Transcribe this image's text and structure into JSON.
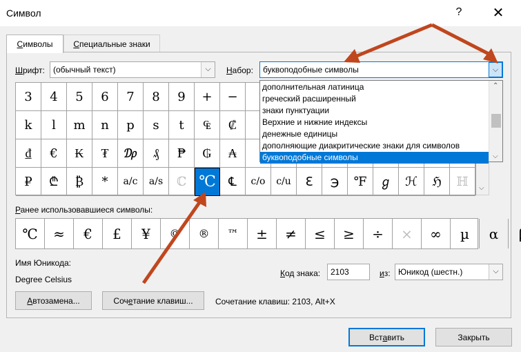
{
  "window": {
    "title": "Символ",
    "help_label": "?",
    "close_label": "✕"
  },
  "tabs": [
    {
      "label_ul": "С",
      "label_rest": "имволы"
    },
    {
      "label_ul": "С",
      "label_rest": "пециальные знаки"
    }
  ],
  "font": {
    "label_ul": "Ш",
    "label_rest": "рифт:",
    "value": "(обычный текст)"
  },
  "subset": {
    "label_ul": "Н",
    "label_rest": "абор:",
    "value": "буквоподобные символы",
    "options": [
      "дополнительная латиница",
      "греческий расширенный",
      "знаки пунктуации",
      "Верхние и нижние индексы",
      "денежные единицы",
      "дополняющие диакритические знаки для символов",
      "буквоподобные символы"
    ],
    "selected_index": 6
  },
  "symbols": [
    [
      "3",
      "4",
      "5",
      "6",
      "7",
      "8",
      "9",
      "+",
      "−",
      "",
      "",
      "",
      "",
      "",
      "",
      "",
      "",
      ""
    ],
    [
      "k",
      "l",
      "m",
      "n",
      "p",
      "s",
      "t",
      "₠",
      "₡",
      "",
      "",
      "",
      "",
      "",
      "",
      "",
      "",
      ""
    ],
    [
      "₫",
      "€",
      "₭",
      "₮",
      "₯",
      "₰",
      "₱",
      "₲",
      "₳",
      "",
      "",
      "",
      "",
      "",
      "",
      "",
      "",
      ""
    ],
    [
      "₽",
      "₾",
      "₿",
      "*",
      "a/c",
      "a/s",
      "ℂ",
      "℃",
      "℄",
      "c/o",
      "c/u",
      "ℇ",
      "℈",
      "℉",
      "ℊ",
      "ℋ",
      "ℌ",
      "ℍ"
    ]
  ],
  "selected_symbol": "℃",
  "recent_label_rest": "анее использовавшиеся символы:",
  "recent_label_ul": "Р",
  "recent": [
    "℃",
    "≈",
    "€",
    "£",
    "¥",
    "©",
    "®",
    "™",
    "±",
    "≠",
    "≤",
    "≥",
    "÷",
    "×",
    "∞",
    "µ",
    "α",
    "β"
  ],
  "unicode_name_label": "Имя Юникода:",
  "unicode_name": "Degree Celsius",
  "char_code": {
    "label_ul": "К",
    "label_rest": "од знака:",
    "value": "2103"
  },
  "from": {
    "label_ul": "и",
    "label_rest": "з:",
    "value": "Юникод (шестн.)"
  },
  "buttons": {
    "autocorrect_ul": "А",
    "autocorrect_rest": "втозамена...",
    "shortcut_pre": "Соч",
    "shortcut_ul": "е",
    "shortcut_rest": "тание клавиш...",
    "insert_pre": "Вст",
    "insert_ul": "а",
    "insert_rest": "вить",
    "close": "Закрыть"
  },
  "shortcut_text": "Сочетание клавиш: 2103, Alt+X",
  "annotation_color": "#c0461e"
}
